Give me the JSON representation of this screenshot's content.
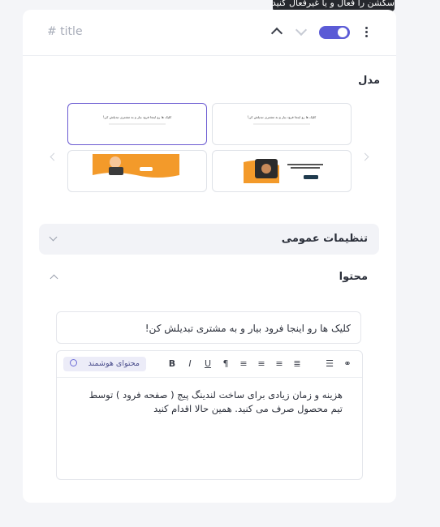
{
  "tooltip": "سکشن را فعال و یا غیرفعال کنید.",
  "header": {
    "title": "# title",
    "toggle_on": true
  },
  "model": {
    "label": "مدل",
    "thumbnails": [
      {
        "text": "کلیک ها رو اینجا فرود بیار و به مشتری تبدیلش کن!",
        "selected": true
      },
      {
        "text": "کلیک ها رو اینجا فرود بیار و به مشتری تبدیلش کن!",
        "selected": false
      }
    ]
  },
  "general_settings": {
    "label": "تنظیمات عمومی"
  },
  "content": {
    "label": "محتوا",
    "title_value": "کلیک ها رو اینجا فرود بیار و به مشتری تبدیلش کن!",
    "smart_content_label": "محتوای هوشمند",
    "body": "هزینه و زمان زیادی برای ساخت لندینگ پیج ( صفحه فرود ) توسط تیم محصول صرف می کنید. همین حالا اقدام کنید"
  },
  "colors": {
    "accent": "#5b5bd6",
    "orange": "#f39a2a"
  }
}
